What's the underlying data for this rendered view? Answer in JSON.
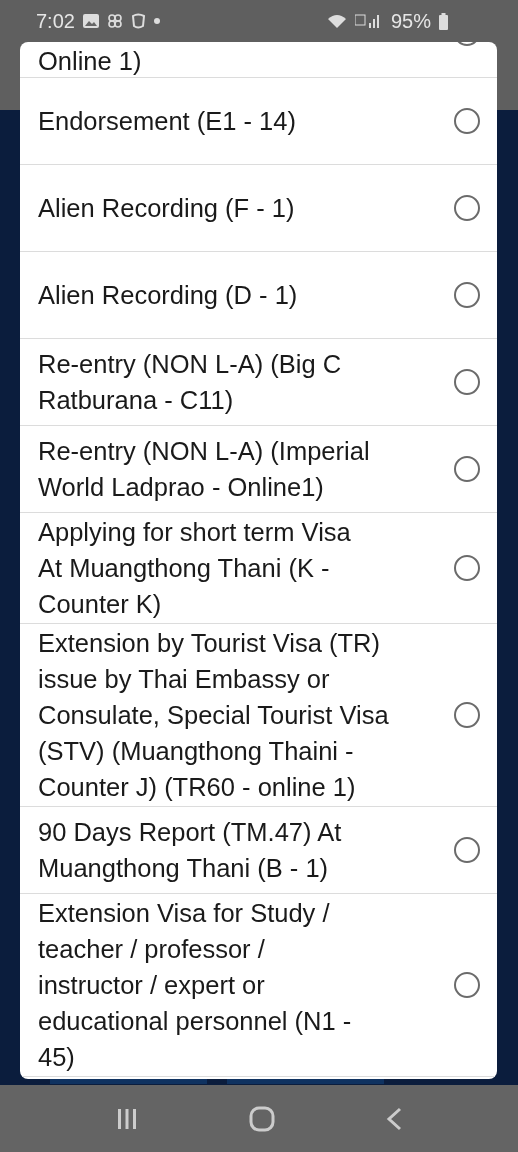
{
  "status_bar": {
    "time": "7:02",
    "battery": "95%"
  },
  "dialog": {
    "options": [
      {
        "label": "Online 1)",
        "selected": false
      },
      {
        "label": "Endorsement (E1 - 14)",
        "selected": false
      },
      {
        "label": "Alien Recording (F - 1)",
        "selected": false
      },
      {
        "label": "Alien Recording (D - 1)",
        "selected": false
      },
      {
        "label": "Re-entry (NON L-A) (Big C\nRatburana - C11)",
        "selected": false
      },
      {
        "label": "Re-entry (NON L-A) (Imperial\nWorld Ladprao - Online1)",
        "selected": false
      },
      {
        "label": "Applying for short term Visa\nAt Muangthong Thani (K -\nCounter K)",
        "selected": false
      },
      {
        "label": "Extension by Tourist Visa (TR)\nissue by Thai Embassy or\nConsulate, Special Tourist Visa\n(STV) (Muangthong Thaini -\nCounter J) (TR60 - online 1)",
        "selected": false
      },
      {
        "label": "90 Days Report (TM.47) At\nMuangthong Thani (B - 1)",
        "selected": false
      },
      {
        "label": "Extension Visa for Study /\nteacher / professor /\ninstructor / expert or\neducational personnel (N1 -\n45)",
        "selected": false
      }
    ]
  }
}
